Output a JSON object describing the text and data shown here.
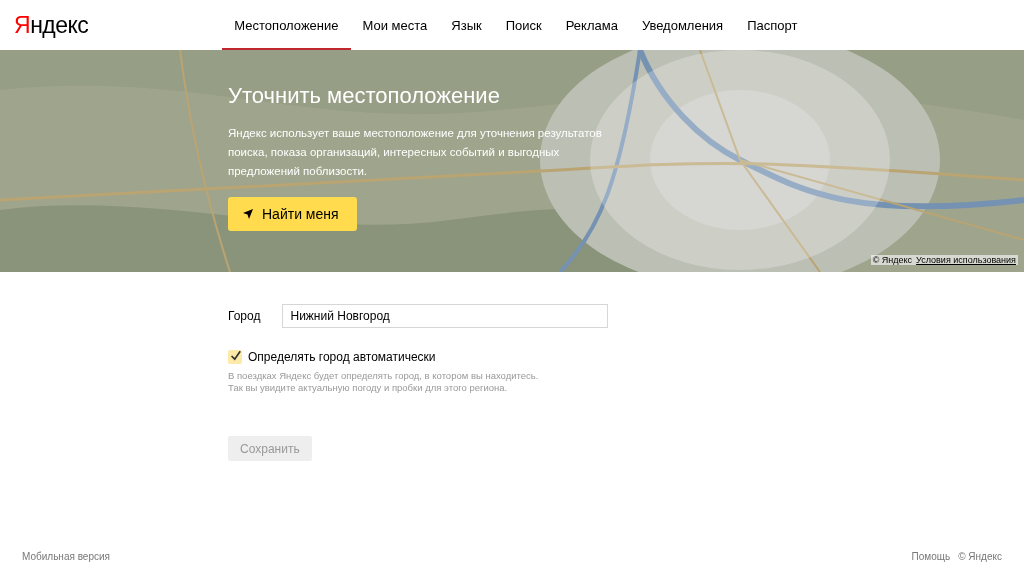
{
  "logo": "Яндекс",
  "nav": [
    {
      "label": "Местоположение",
      "selected": true
    },
    {
      "label": "Мои места",
      "selected": false
    },
    {
      "label": "Язык",
      "selected": false
    },
    {
      "label": "Поиск",
      "selected": false
    },
    {
      "label": "Реклама",
      "selected": false
    },
    {
      "label": "Уведомления",
      "selected": false
    },
    {
      "label": "Паспорт",
      "selected": false
    }
  ],
  "hero": {
    "title": "Уточнить местоположение",
    "text": "Яндекс использует ваше местоположение для уточнения результатов поиска, показа организаций, интересных событий и выгодных предложений поблизости.",
    "button": "Найти меня",
    "copyright": "© Яндекс",
    "terms_link": "Условия использования"
  },
  "form": {
    "city_label": "Город",
    "city_value": "Нижний Новгород",
    "auto_label": "Определять город автоматически",
    "auto_checked": true,
    "hint_lines": [
      "В поездках Яндекс будет определять город, в котором вы находитесь.",
      "Так вы увидите актуальную погоду и пробки для этого региона."
    ],
    "save_button": "Сохранить",
    "save_disabled": true
  },
  "footer": {
    "mobile_link": "Мобильная версия",
    "help_link": "Помощь",
    "copyright": "© Яндекс"
  }
}
